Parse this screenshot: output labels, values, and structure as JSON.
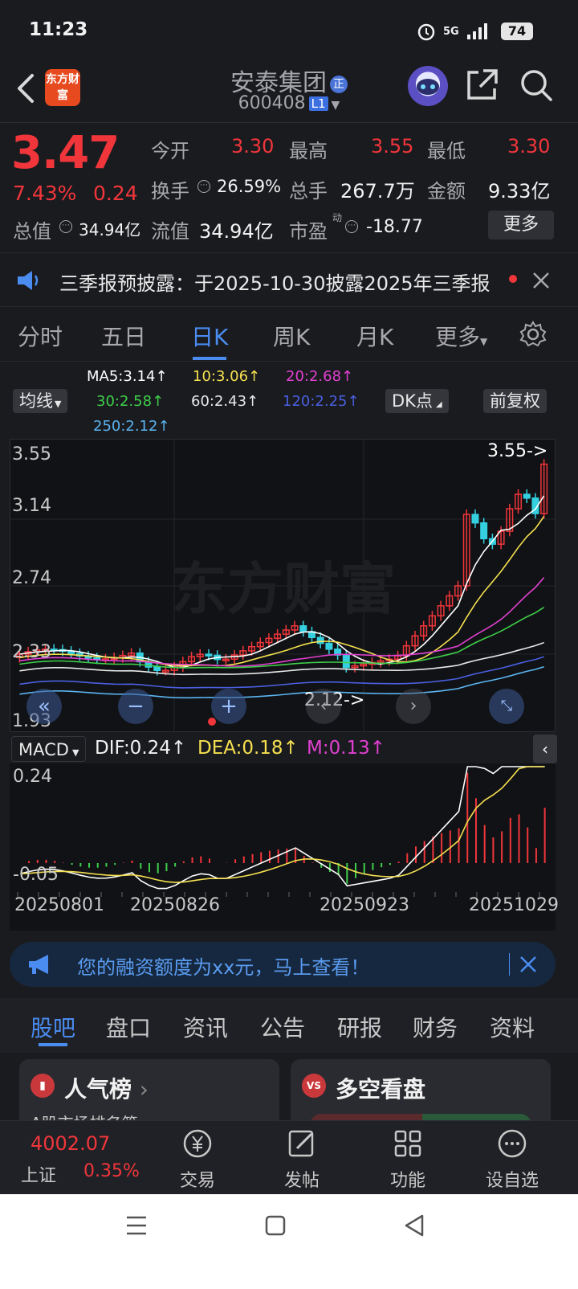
{
  "status": {
    "time": "11:23",
    "network": "5G",
    "battery": "74"
  },
  "header": {
    "logo_text": "东方财富",
    "stock_name": "安泰集团",
    "badge": "正",
    "stock_code": "600408",
    "level_badge": "L1"
  },
  "quote": {
    "price": "3.47",
    "change_pct": "7.43%",
    "change": "0.24",
    "open_label": "今开",
    "open": "3.30",
    "high_label": "最高",
    "high": "3.55",
    "low_label": "最低",
    "low": "3.30",
    "turnover_label": "换手",
    "turnover": "26.59%",
    "volume_label": "总手",
    "volume": "267.7万",
    "amount_label": "金额",
    "amount": "9.33亿",
    "mcap_label": "总值",
    "mcap": "34.94亿",
    "float_label": "流值",
    "float_mcap": "34.94亿",
    "pe_label": "市盈",
    "pe_sup": "动",
    "pe": "-18.77",
    "more": "更多"
  },
  "notice": {
    "text": "三季报预披露：于2025-10-30披露2025年三季报"
  },
  "chart_tabs": [
    "分时",
    "五日",
    "日K",
    "周K",
    "月K",
    "更多"
  ],
  "indicators": {
    "ma_button": "均线",
    "ma5": "MA5:3.14↑",
    "ma10": "10:3.06↑",
    "ma20": "20:2.68↑",
    "ma30": "30:2.58↑",
    "ma60": "60:2.43↑",
    "ma120": "120:2.25↑",
    "ma250": "250:2.12↑",
    "dk_button": "DK点",
    "adjust_button": "前复权",
    "colors": {
      "ma5": "#ffffff",
      "ma10": "#f5e050",
      "ma20": "#e040d0",
      "ma30": "#3ecf4a",
      "ma60": "#e8e8e8",
      "ma120": "#4a5fe0",
      "ma250": "#5ab4f0",
      "up": "#f0363b",
      "down": "#35d0e0"
    }
  },
  "kline": {
    "y_labels": [
      "3.55",
      "3.14",
      "2.74",
      "2.33",
      "1.93"
    ],
    "max_marker": "3.55->",
    "min_marker": "2.12->",
    "watermark": "东方财富"
  },
  "macd": {
    "button": "MACD",
    "dif": "DIF:0.24↑",
    "dea": "DEA:0.18↑",
    "m": "M:0.13↑",
    "y_top": "0.24",
    "y_bottom": "-0.05"
  },
  "dates": [
    "20250801",
    "20250826",
    "20250923",
    "20251029"
  ],
  "margin_banner": {
    "text": "您的融资额度为xx元，马上查看！"
  },
  "bottom_tabs": [
    "股吧",
    "盘口",
    "资讯",
    "公告",
    "研报",
    "财务",
    "资料"
  ],
  "cards": {
    "popular": "人气榜",
    "popular_sub": "A股市场排名第",
    "longshort": "多空看盘"
  },
  "index": {
    "value": "4002.07",
    "name": "上证",
    "pct": "0.35%"
  },
  "nav": [
    "交易",
    "发帖",
    "功能",
    "设自选"
  ]
}
